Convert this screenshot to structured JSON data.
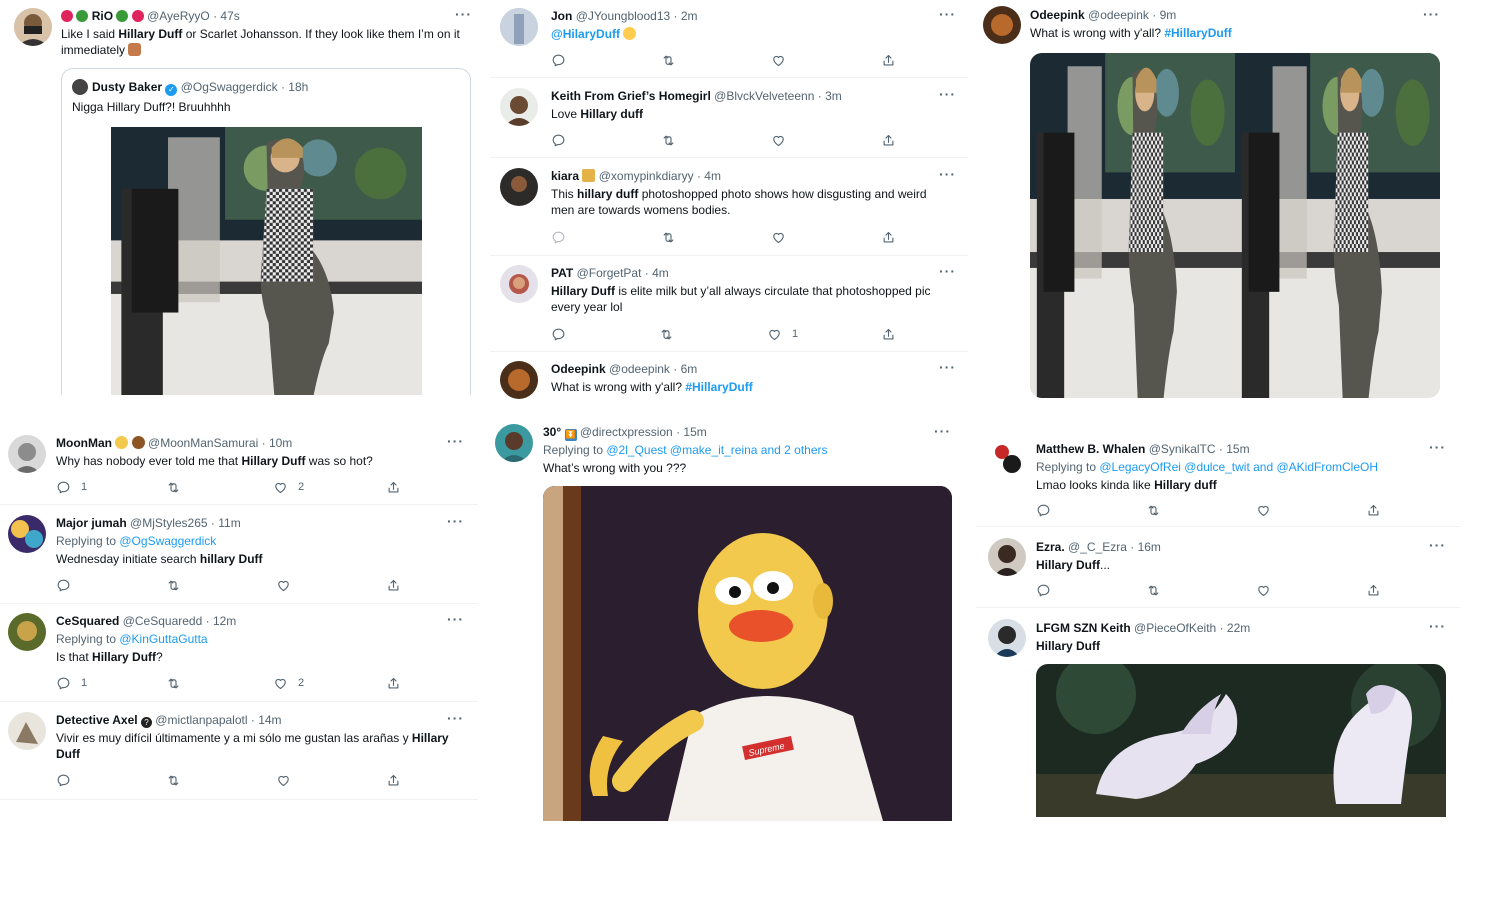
{
  "panel1": {
    "main": {
      "name": "RiO",
      "handle": "@AyeRyyO",
      "time": "· 47s",
      "text_a": "Like I said ",
      "text_b": "Hillary Duff",
      "text_c": " or Scarlet Johansson. If they look like them I’m on it immediately",
      "quote": {
        "name": "Dusty Baker",
        "handle": "@OgSwaggerdick",
        "time": "· 18h",
        "text": "Nigga Hillary Duff?! Bruuhhhh"
      }
    }
  },
  "panel2": {
    "tweets": [
      {
        "name": "Jon",
        "handle": "@JYoungblood13",
        "time": "· 2m",
        "text": "@HilaryDuff"
      },
      {
        "name": "Keith From Grief’s Homegirl",
        "handle": "@BlvckVelveteenn",
        "time": "· 3m",
        "text_a": "Love ",
        "text_b": "Hillary duff"
      },
      {
        "name": "kiara",
        "handle": "@xomypinkdiaryy",
        "time": "· 4m",
        "text_a": "This ",
        "text_b": "hillary duff",
        "text_c": " photoshopped photo shows how disgusting and weird men are towards womens bodies."
      },
      {
        "name": "PAT",
        "handle": "@ForgetPat",
        "time": "· 4m",
        "text_b": "Hillary Duff",
        "text_c": " is elite milk but y’all always circulate that photoshopped pic every year lol",
        "likes": "1"
      },
      {
        "name": "Odeepink",
        "handle": "@odeepink",
        "time": "· 6m",
        "text": "What is wrong with y'all? ",
        "hashtag": "#HillaryDuff"
      }
    ]
  },
  "panel3": {
    "name": "Odeepink",
    "handle": "@odeepink",
    "time": "· 9m",
    "text": "What is wrong with y'all? ",
    "hashtag": "#HillaryDuff"
  },
  "panel4": {
    "tweets": [
      {
        "name": "MoonMan",
        "handle": "@MoonManSamurai",
        "time": "· 10m",
        "text_a": "Why has nobody ever told me that ",
        "text_b": "Hillary Duff",
        "text_c": " was so hot?",
        "replies": "1",
        "likes": "2"
      },
      {
        "name": "Major jumah",
        "handle": "@MjStyles265",
        "time": "· 11m",
        "reply_prefix": "Replying to ",
        "reply_to": "@OgSwaggerdick",
        "text_a": "Wednesday initiate search ",
        "text_b": "hillary Duff"
      },
      {
        "name": "CeSquared",
        "handle": "@CeSquaredd",
        "time": "· 12m",
        "reply_prefix": "Replying to ",
        "reply_to": "@KinGuttaGutta",
        "text_a": "Is that ",
        "text_b": "Hillary Duff",
        "text_c": "?",
        "replies": "1",
        "likes": "2"
      },
      {
        "name": "Detective Axel",
        "handle": "@mictlanpapalotl",
        "time": "· 14m",
        "text_a": "Vivir es muy difícil últimamente y a mi sólo me gustan las arañas y ",
        "text_b": "Hillary Duff"
      }
    ]
  },
  "panel5": {
    "name": "30°",
    "handle": "@directxpression",
    "time": "· 15m",
    "reply_prefix": "Replying to ",
    "reply_to": "@2l_Quest @make_it_reina and 2 others",
    "text": "What’s wrong with you ???",
    "shirt_text": "Supreme"
  },
  "panel6": {
    "tweets": [
      {
        "name": "Matthew B. Whalen",
        "handle": "@SynikalTC",
        "time": "· 15m",
        "reply_prefix": "Replying to ",
        "reply_to": "@LegacyOfRei @dulce_twit and @AKidFromCleOH",
        "text_a": "Lmao looks kinda like ",
        "text_b": "Hillary duff"
      },
      {
        "name": "Ezra.",
        "handle": "@_C_Ezra",
        "time": "· 16m",
        "text_b": "Hillary Duff",
        "text_c": "..."
      },
      {
        "name": "LFGM SZN Keith",
        "handle": "@PieceOfKeith",
        "time": "· 22m",
        "text_b": "Hillary Duff"
      }
    ]
  },
  "more_label": "···",
  "colors": {
    "link": "#1d9bf0",
    "muted": "#536471",
    "divider": "#eff3f4",
    "quote_border": "#cfd9de"
  }
}
